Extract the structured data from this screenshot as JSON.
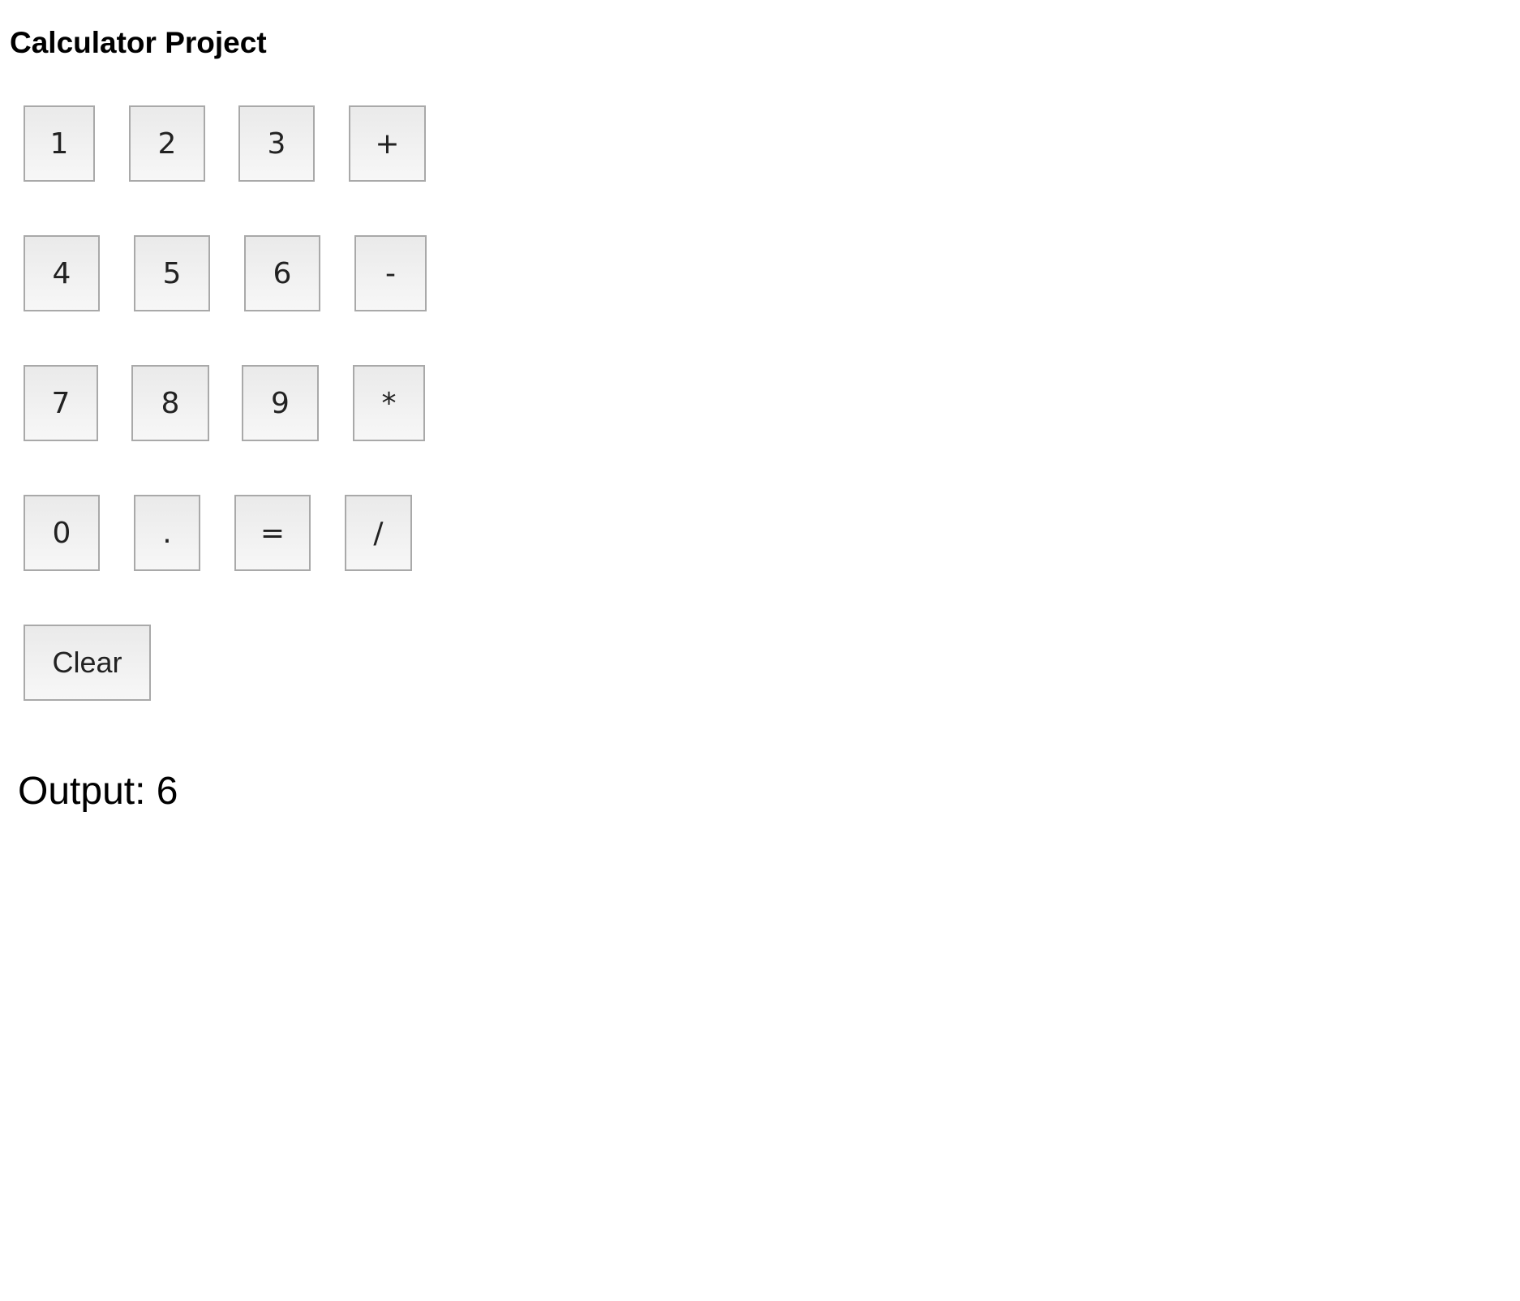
{
  "page": {
    "title": "Calculator Project"
  },
  "keypad": {
    "row1": [
      "1",
      "2",
      "3",
      "+"
    ],
    "row2": [
      "4",
      "5",
      "6",
      "-"
    ],
    "row3": [
      "7",
      "8",
      "9",
      "*"
    ],
    "row4": [
      "0",
      ".",
      "=",
      "/"
    ],
    "clear_label": "Clear"
  },
  "output": {
    "label": "Output:",
    "value": "6"
  }
}
